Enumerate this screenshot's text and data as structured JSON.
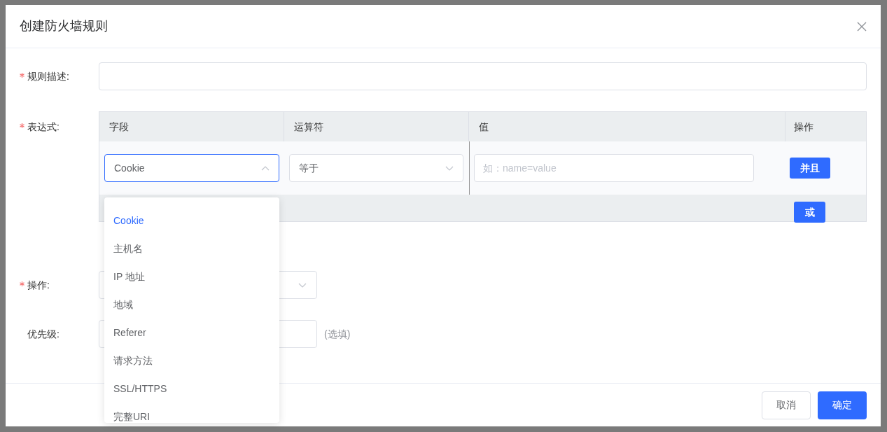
{
  "dialog": {
    "title": "创建防火墙规则"
  },
  "form": {
    "description": {
      "label": "规则描述:",
      "required": true
    },
    "expression": {
      "label": "表达式:",
      "required": true,
      "columns": [
        "字段",
        "运算符",
        "值",
        "操作"
      ],
      "row": {
        "field": "Cookie",
        "operator": "等于",
        "value_placeholder": "如：name=value",
        "and_button": "并且"
      },
      "or_button": "或",
      "field_dropdown": {
        "expanded": true,
        "options": [
          {
            "label": "Cookie",
            "selected": true
          },
          {
            "label": "主机名",
            "selected": false
          },
          {
            "label": "IP 地址",
            "selected": false
          },
          {
            "label": "地域",
            "selected": false
          },
          {
            "label": "Referer",
            "selected": false
          },
          {
            "label": "请求方法",
            "selected": false
          },
          {
            "label": "SSL/HTTPS",
            "selected": false
          },
          {
            "label": "完整URI",
            "selected": false
          }
        ]
      }
    },
    "action": {
      "label": "操作:",
      "required": true
    },
    "priority": {
      "label": "优先级:",
      "required": false,
      "hint": "(选填)"
    }
  },
  "buttons": {
    "cancel": "取消",
    "ok": "确定"
  }
}
